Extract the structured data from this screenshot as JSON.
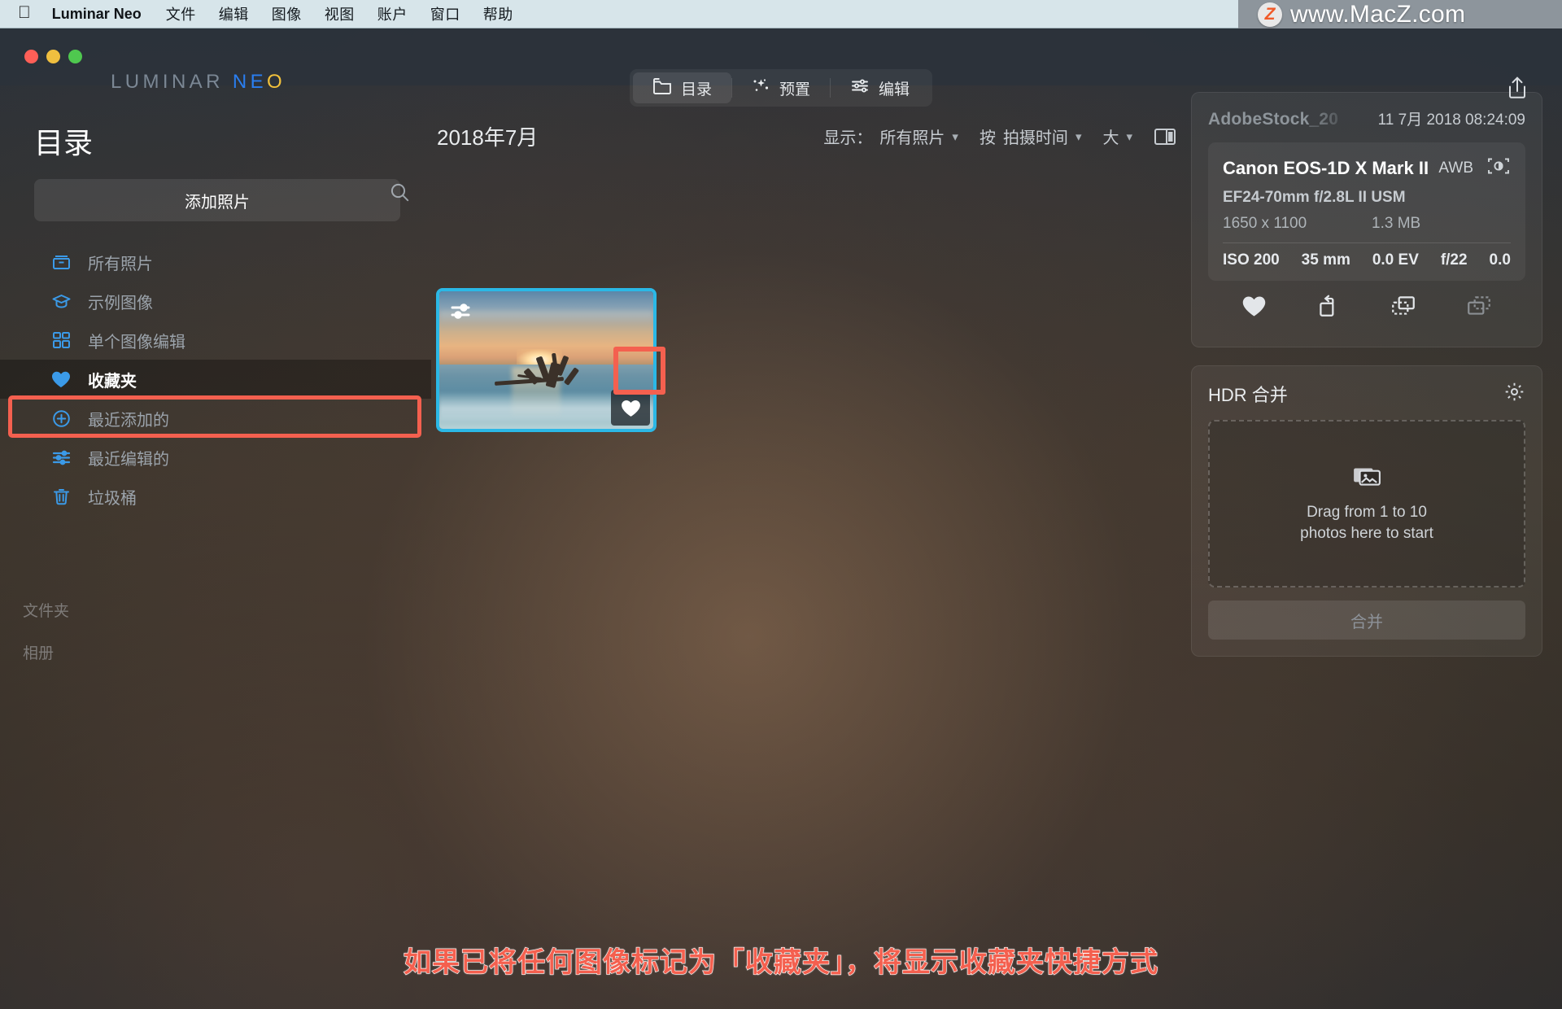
{
  "menubar": {
    "apple_icon": "apple-logo-icon",
    "app_name": "Luminar Neo",
    "items": [
      "文件",
      "编辑",
      "图像",
      "视图",
      "账户",
      "窗口",
      "帮助"
    ]
  },
  "watermark": {
    "badge": "Z",
    "text": "www.MacZ.com"
  },
  "brand": {
    "part1": "LUMINAR",
    "part2": "NE",
    "part3": "O"
  },
  "toolbar": {
    "tabs": [
      {
        "label": "目录",
        "icon": "folder-icon",
        "active": true
      },
      {
        "label": "预置",
        "icon": "sparkles-icon",
        "active": false
      },
      {
        "label": "编辑",
        "icon": "sliders-icon",
        "active": false
      }
    ],
    "share_icon": "share-icon"
  },
  "sidebar": {
    "title": "目录",
    "search_icon": "search-icon",
    "add_photos_label": "添加照片",
    "items": [
      {
        "label": "所有照片",
        "icon": "archive-box-icon",
        "selected": false
      },
      {
        "label": "示例图像",
        "icon": "graduation-cap-icon",
        "selected": false
      },
      {
        "label": "单个图像编辑",
        "icon": "grid-icon",
        "selected": false
      },
      {
        "label": "收藏夹",
        "icon": "heart-icon",
        "selected": true
      },
      {
        "label": "最近添加的",
        "icon": "plus-circle-icon",
        "selected": false
      },
      {
        "label": "最近编辑的",
        "icon": "sliders-icon",
        "selected": false
      },
      {
        "label": "垃圾桶",
        "icon": "trash-icon",
        "selected": false
      }
    ],
    "sections": {
      "folders": "文件夹",
      "albums": "相册"
    }
  },
  "content": {
    "month_title": "2018年7月",
    "controls": {
      "show_label": "显示：",
      "show_value": "所有照片",
      "sort_label": "按",
      "sort_value": "拍摄时间",
      "size_value": "大",
      "panel_toggle_icon": "split-panel-icon"
    },
    "thumbnail": {
      "edited_badge_icon": "sliders-icon",
      "favorite_icon": "heart-icon"
    }
  },
  "info_panel": {
    "filename": "AdobeStock_20",
    "date": "11 7月 2018 08:24:09",
    "camera": "Canon EOS-1D X Mark II",
    "white_balance": "AWB",
    "camera_icon": "camera-icon",
    "lens": "EF24-70mm f/2.8L II USM",
    "dimensions": "1650 x 1100",
    "filesize": "1.3 MB",
    "shot": [
      "ISO 200",
      "35 mm",
      "0.0 EV",
      "f/22",
      "0.0"
    ],
    "actions": [
      "favorite-icon",
      "rotate-icon",
      "copy-settings-icon",
      "paste-settings-icon"
    ]
  },
  "hdr_panel": {
    "title": "HDR 合并",
    "settings_icon": "gear-icon",
    "dropzone_icon": "photos-icon",
    "dropzone_line1": "Drag from 1 to 10",
    "dropzone_line2": "photos here to start",
    "merge_label": "合并"
  },
  "caption": "如果已将任何图像标记为「收藏夹」，将显示收藏夹快捷方式",
  "colors": {
    "accent_blue": "#2bb8e6",
    "highlight_red": "#f4604f",
    "icon_blue": "#3b9ae8",
    "brand_blue": "#2a7ef0",
    "brand_yellow": "#f2c13b"
  }
}
